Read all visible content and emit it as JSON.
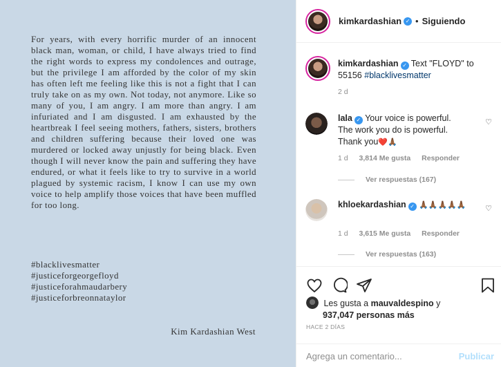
{
  "post": {
    "body": "For years, with every horrific murder of an innocent black man, woman, or child, I have always tried to find the right words to express my condolences and outrage, but the privilege I am afforded by the color of my skin has often left me feeling like this is not a fight that I can truly take on as my own. Not today, not anymore. Like so many of you, I am angry. I am more than angry. I am infuriated and I am disgusted. I am exhausted by the heartbreak I feel seeing mothers, fathers, sisters, brothers and children suffering because their loved one was murdered or locked away unjustly for being black. Even though I will never know the pain and suffering they have endured, or what it feels like to try to survive in a world plagued by systemic racism, I know I can use my own voice to help amplify those voices that have been muffled for too long.",
    "hashtags": [
      "#blacklivesmatter",
      "#justiceforgeorgefloyd",
      "#justiceforahmaudarbery",
      "#justiceforbreonnataylor"
    ],
    "signature": "Kim Kardashian West"
  },
  "header": {
    "username": "kimkardashian",
    "separator": "•",
    "follow_label": "Siguiendo"
  },
  "caption": {
    "username": "kimkardashian",
    "text": "Text \"FLOYD\" to 55156",
    "hashtag": "#blacklivesmatter",
    "time": "2 d"
  },
  "comments": [
    {
      "username": "lala",
      "text": "Your voice is powerful. The work you do is powerful. Thank you",
      "emoji": "❤️🙏🏾",
      "time": "1 d",
      "likes": "3,814 Me gusta",
      "reply_label": "Responder",
      "view_replies": "Ver respuestas (167)"
    },
    {
      "username": "khloekardashian",
      "text": "",
      "emoji": "🙏🏾🙏🏾🙏🏾🙏🏾🙏🏾",
      "time": "1 d",
      "likes": "3,615 Me gusta",
      "reply_label": "Responder",
      "view_replies": "Ver respuestas (163)"
    }
  ],
  "likes": {
    "prefix": "Les gusta a",
    "user": "mauvaldespino",
    "connector": "y",
    "others": "937,047 personas más"
  },
  "timestamp": "HACE 2 DÍAS",
  "comment_input": {
    "placeholder": "Agrega un comentario...",
    "publish_label": "Publicar"
  },
  "icons": [
    "heart-icon",
    "comment-icon",
    "share-icon",
    "bookmark-icon",
    "verified-icon"
  ],
  "colors": {
    "accent": "#3897f0",
    "image_bg": "#c9d8e6",
    "muted": "#8e8e8e",
    "publish": "#b2dffc"
  }
}
